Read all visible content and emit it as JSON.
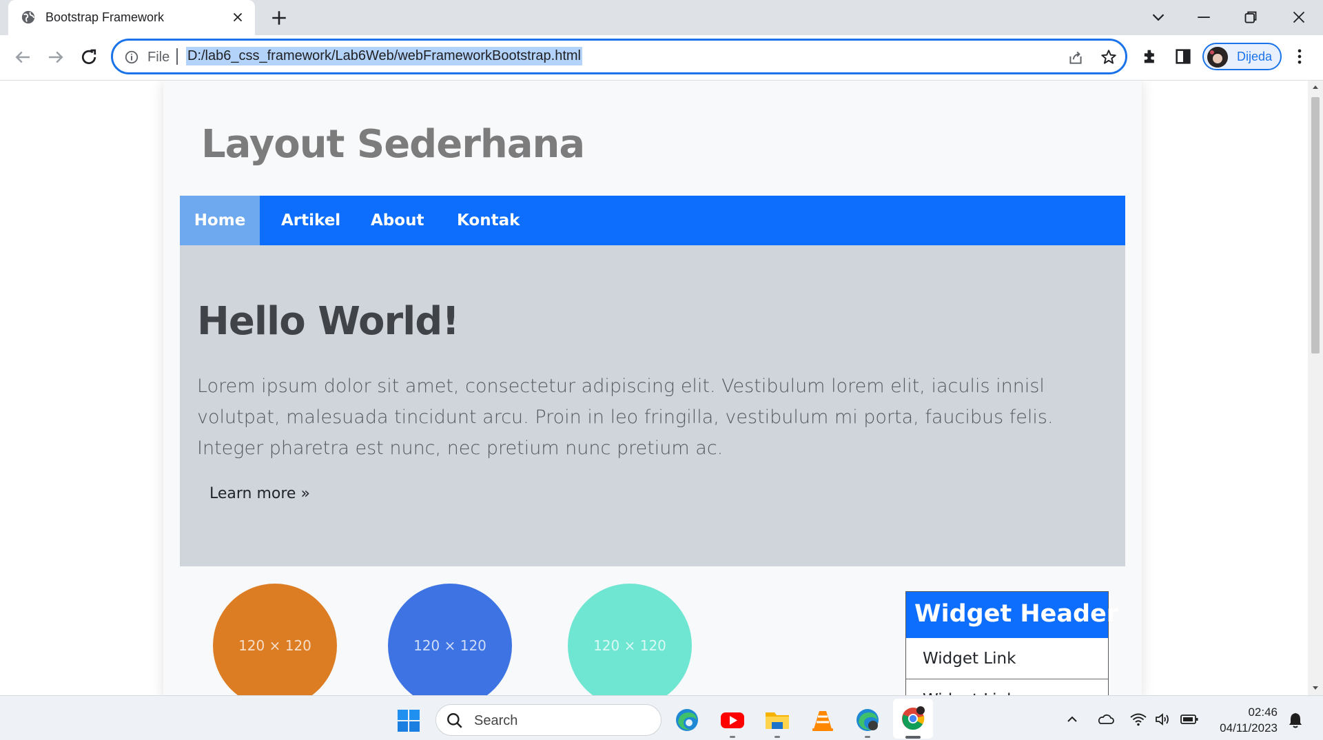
{
  "browser": {
    "tab_title": "Bootstrap Framework",
    "url_scheme": "File",
    "url": "D:/lab6_css_framework/Lab6Web/webFrameworkBootstrap.html",
    "profile_name": "Dijeda"
  },
  "page": {
    "site_title": "Layout Sederhana",
    "nav": [
      {
        "label": "Home",
        "active": true
      },
      {
        "label": "Artikel",
        "active": false
      },
      {
        "label": "About",
        "active": false
      },
      {
        "label": "Kontak",
        "active": false
      }
    ],
    "hero": {
      "title": "Hello World!",
      "text": "Lorem ipsum dolor sit amet, consectetur adipiscing elit. Vestibulum lorem elit, iaculis innisl volutpat, malesuada tincidunt arcu. Proin in leo fringilla, vestibulum mi porta, faucibus felis. Integer pharetra est nunc, nec pretium nunc pretium ac.",
      "link": "Learn more »"
    },
    "placeholders": [
      {
        "label": "120 × 120",
        "color": "#dc7d24"
      },
      {
        "label": "120 × 120",
        "color": "#3e73e3"
      },
      {
        "label": "120 × 120",
        "color": "#6ee6d2"
      }
    ],
    "widget": {
      "header": "Widget Header",
      "links": [
        "Widget Link",
        "Widget Link"
      ]
    }
  },
  "taskbar": {
    "search_placeholder": "Search",
    "time": "02:46",
    "date": "04/11/2023"
  },
  "colors": {
    "primary": "#0d6efd",
    "nav_active": "#6ea8ef",
    "jumbotron_bg": "#d0d4db",
    "focus_ring": "#1a73e8"
  }
}
